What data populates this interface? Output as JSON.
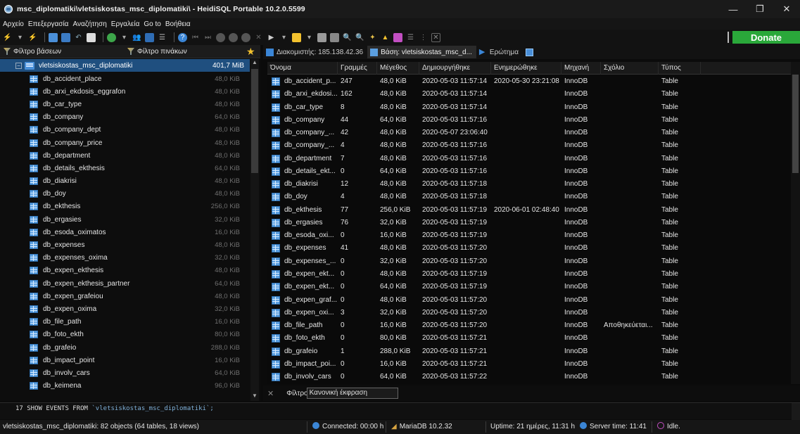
{
  "window": {
    "title": "msc_diplomatiki\\vletsiskostas_msc_diplomatiki\\ - HeidiSQL Portable 10.2.0.5599",
    "controls": [
      "—",
      "❐",
      "✕"
    ]
  },
  "menu": [
    "Αρχείο",
    "Επεξεργασία",
    "Αναζήτηση",
    "Εργαλεία",
    "Go to",
    "Βοήθεια"
  ],
  "toolbar": {
    "donate_label": "Donate"
  },
  "left": {
    "db_filter": "Φίλτρο βάσεων",
    "table_filter": "Φίλτρο πινάκων",
    "root": {
      "name": "vletsiskostas_msc_diplomatiki",
      "size": "401,7 MiB"
    },
    "items": [
      {
        "name": "db_accident_place",
        "size": "48,0 KiB"
      },
      {
        "name": "db_arxi_ekdosis_eggrafon",
        "size": "48,0 KiB"
      },
      {
        "name": "db_car_type",
        "size": "48,0 KiB"
      },
      {
        "name": "db_company",
        "size": "64,0 KiB"
      },
      {
        "name": "db_company_dept",
        "size": "48,0 KiB"
      },
      {
        "name": "db_company_price",
        "size": "48,0 KiB"
      },
      {
        "name": "db_department",
        "size": "48,0 KiB"
      },
      {
        "name": "db_details_ekthesis",
        "size": "64,0 KiB"
      },
      {
        "name": "db_diakrisi",
        "size": "48,0 KiB"
      },
      {
        "name": "db_doy",
        "size": "48,0 KiB"
      },
      {
        "name": "db_ekthesis",
        "size": "256,0 KiB"
      },
      {
        "name": "db_ergasies",
        "size": "32,0 KiB"
      },
      {
        "name": "db_esoda_oximatos",
        "size": "16,0 KiB"
      },
      {
        "name": "db_expenses",
        "size": "48,0 KiB"
      },
      {
        "name": "db_expenses_oxima",
        "size": "32,0 KiB"
      },
      {
        "name": "db_expen_ekthesis",
        "size": "48,0 KiB"
      },
      {
        "name": "db_expen_ekthesis_partner",
        "size": "64,0 KiB"
      },
      {
        "name": "db_expen_grafeiou",
        "size": "48,0 KiB"
      },
      {
        "name": "db_expen_oxima",
        "size": "32,0 KiB"
      },
      {
        "name": "db_file_path",
        "size": "16,0 KiB"
      },
      {
        "name": "db_foto_ekth",
        "size": "80,0 KiB"
      },
      {
        "name": "db_grafeio",
        "size": "288,0 KiB"
      },
      {
        "name": "db_impact_point",
        "size": "16,0 KiB"
      },
      {
        "name": "db_involv_cars",
        "size": "64,0 KiB"
      },
      {
        "name": "db_keimena",
        "size": "96,0 KiB"
      }
    ]
  },
  "tabs": {
    "host": "Διακομιστής: 185.138.42.36",
    "database": "Βάση: vletsiskostas_msc_d...",
    "query": "Ερώτημα"
  },
  "grid": {
    "columns": [
      "Όνομα",
      "Γραμμές",
      "Μέγεθος",
      "Δημιουργήθηκε",
      "Ενημερώθηκε",
      "Μηχανή",
      "Σχόλιο",
      "Τύπος"
    ],
    "rows": [
      [
        "db_accident_p...",
        "247",
        "48,0 KiB",
        "2020-05-03 11:57:14",
        "2020-05-30 23:21:08",
        "InnoDB",
        "",
        "Table"
      ],
      [
        "db_arxi_ekdosi...",
        "162",
        "48,0 KiB",
        "2020-05-03 11:57:14",
        "",
        "InnoDB",
        "",
        "Table"
      ],
      [
        "db_car_type",
        "8",
        "48,0 KiB",
        "2020-05-03 11:57:14",
        "",
        "InnoDB",
        "",
        "Table"
      ],
      [
        "db_company",
        "44",
        "64,0 KiB",
        "2020-05-03 11:57:16",
        "",
        "InnoDB",
        "",
        "Table"
      ],
      [
        "db_company_...",
        "42",
        "48,0 KiB",
        "2020-05-07 23:06:40",
        "",
        "InnoDB",
        "",
        "Table"
      ],
      [
        "db_company_...",
        "4",
        "48,0 KiB",
        "2020-05-03 11:57:16",
        "",
        "InnoDB",
        "",
        "Table"
      ],
      [
        "db_department",
        "7",
        "48,0 KiB",
        "2020-05-03 11:57:16",
        "",
        "InnoDB",
        "",
        "Table"
      ],
      [
        "db_details_ekt...",
        "0",
        "64,0 KiB",
        "2020-05-03 11:57:16",
        "",
        "InnoDB",
        "",
        "Table"
      ],
      [
        "db_diakrisi",
        "12",
        "48,0 KiB",
        "2020-05-03 11:57:18",
        "",
        "InnoDB",
        "",
        "Table"
      ],
      [
        "db_doy",
        "4",
        "48,0 KiB",
        "2020-05-03 11:57:18",
        "",
        "InnoDB",
        "",
        "Table"
      ],
      [
        "db_ekthesis",
        "77",
        "256,0 KiB",
        "2020-05-03 11:57:19",
        "2020-06-01 02:48:40",
        "InnoDB",
        "",
        "Table"
      ],
      [
        "db_ergasies",
        "76",
        "32,0 KiB",
        "2020-05-03 11:57:19",
        "",
        "InnoDB",
        "",
        "Table"
      ],
      [
        "db_esoda_oxi...",
        "0",
        "16,0 KiB",
        "2020-05-03 11:57:19",
        "",
        "InnoDB",
        "",
        "Table"
      ],
      [
        "db_expenses",
        "41",
        "48,0 KiB",
        "2020-05-03 11:57:20",
        "",
        "InnoDB",
        "",
        "Table"
      ],
      [
        "db_expenses_...",
        "0",
        "32,0 KiB",
        "2020-05-03 11:57:20",
        "",
        "InnoDB",
        "",
        "Table"
      ],
      [
        "db_expen_ekt...",
        "0",
        "48,0 KiB",
        "2020-05-03 11:57:19",
        "",
        "InnoDB",
        "",
        "Table"
      ],
      [
        "db_expen_ekt...",
        "0",
        "64,0 KiB",
        "2020-05-03 11:57:19",
        "",
        "InnoDB",
        "",
        "Table"
      ],
      [
        "db_expen_graf...",
        "0",
        "48,0 KiB",
        "2020-05-03 11:57:20",
        "",
        "InnoDB",
        "",
        "Table"
      ],
      [
        "db_expen_oxi...",
        "3",
        "32,0 KiB",
        "2020-05-03 11:57:20",
        "",
        "InnoDB",
        "",
        "Table"
      ],
      [
        "db_file_path",
        "0",
        "16,0 KiB",
        "2020-05-03 11:57:20",
        "",
        "InnoDB",
        "Αποθηκεύεται...",
        "Table"
      ],
      [
        "db_foto_ekth",
        "0",
        "80,0 KiB",
        "2020-05-03 11:57:21",
        "",
        "InnoDB",
        "",
        "Table"
      ],
      [
        "db_grafeio",
        "1",
        "288,0 KiB",
        "2020-05-03 11:57:21",
        "",
        "InnoDB",
        "",
        "Table"
      ],
      [
        "db_impact_poi...",
        "0",
        "16,0 KiB",
        "2020-05-03 11:57:21",
        "",
        "InnoDB",
        "",
        "Table"
      ],
      [
        "db_involv_cars",
        "0",
        "64,0 KiB",
        "2020-05-03 11:57:22",
        "",
        "InnoDB",
        "",
        "Table"
      ]
    ]
  },
  "filter": {
    "label": "Φίλτρο",
    "regex_placeholder": "Κανονική έκφραση"
  },
  "sql_log": {
    "line_no": "17",
    "keyword": "SHOW EVENTS FROM",
    "arg": "`vletsiskostas_msc_diplomatiki`;"
  },
  "status": {
    "objects": "vletsiskostas_msc_diplomatiki: 82 objects (64 tables, 18 views)",
    "connected": "Connected: 00:00 h",
    "server": "MariaDB 10.2.32",
    "uptime": "Uptime: 21 ημέρες, 11:31 h",
    "server_time": "Server time: 11:41",
    "state": "Idle."
  },
  "colors": {
    "selection": "#1f4f7f",
    "donate": "#2aa83a",
    "table_icon": "#5b9fe0"
  }
}
